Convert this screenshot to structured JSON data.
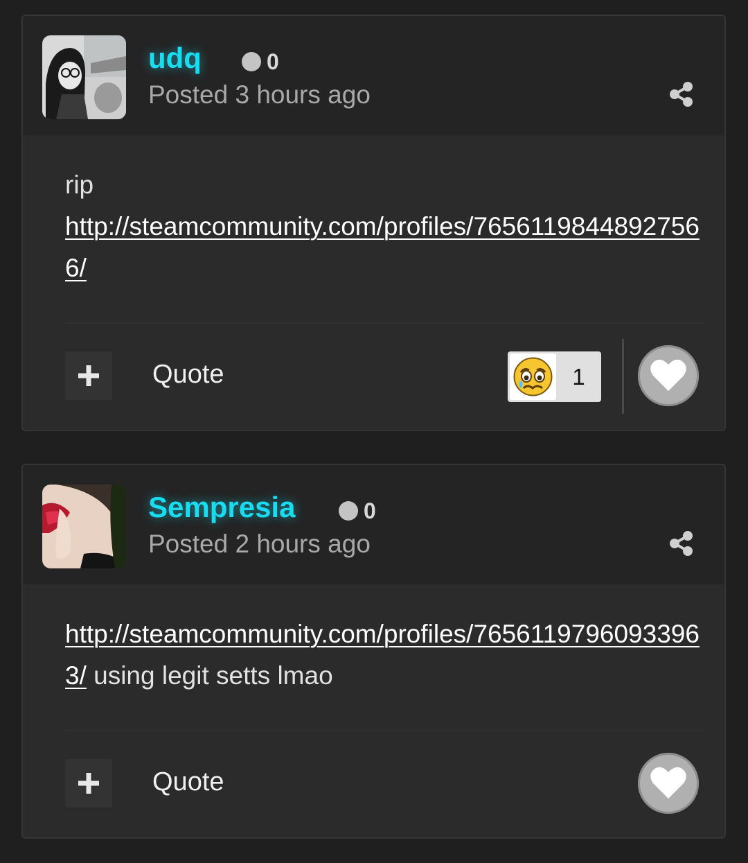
{
  "posts": [
    {
      "author": "udq",
      "reputation": "0",
      "posted": "Posted 3 hours ago",
      "body_text": "rip",
      "body_link": "http://steamcommunity.com/profiles/76561198448927566/",
      "body_suffix": "",
      "quote_label": "Quote",
      "reaction": {
        "emoji": "crying-face-emoji",
        "count": "1"
      },
      "author_color": "#19dcf0"
    },
    {
      "author": "Sempresia",
      "reputation": "0",
      "posted": "Posted 2 hours ago",
      "body_text": "",
      "body_link": "http://steamcommunity.com/profiles/76561197960933963/",
      "body_suffix": " using legit setts lmao",
      "quote_label": "Quote",
      "author_color": "#19dcf0"
    }
  ]
}
